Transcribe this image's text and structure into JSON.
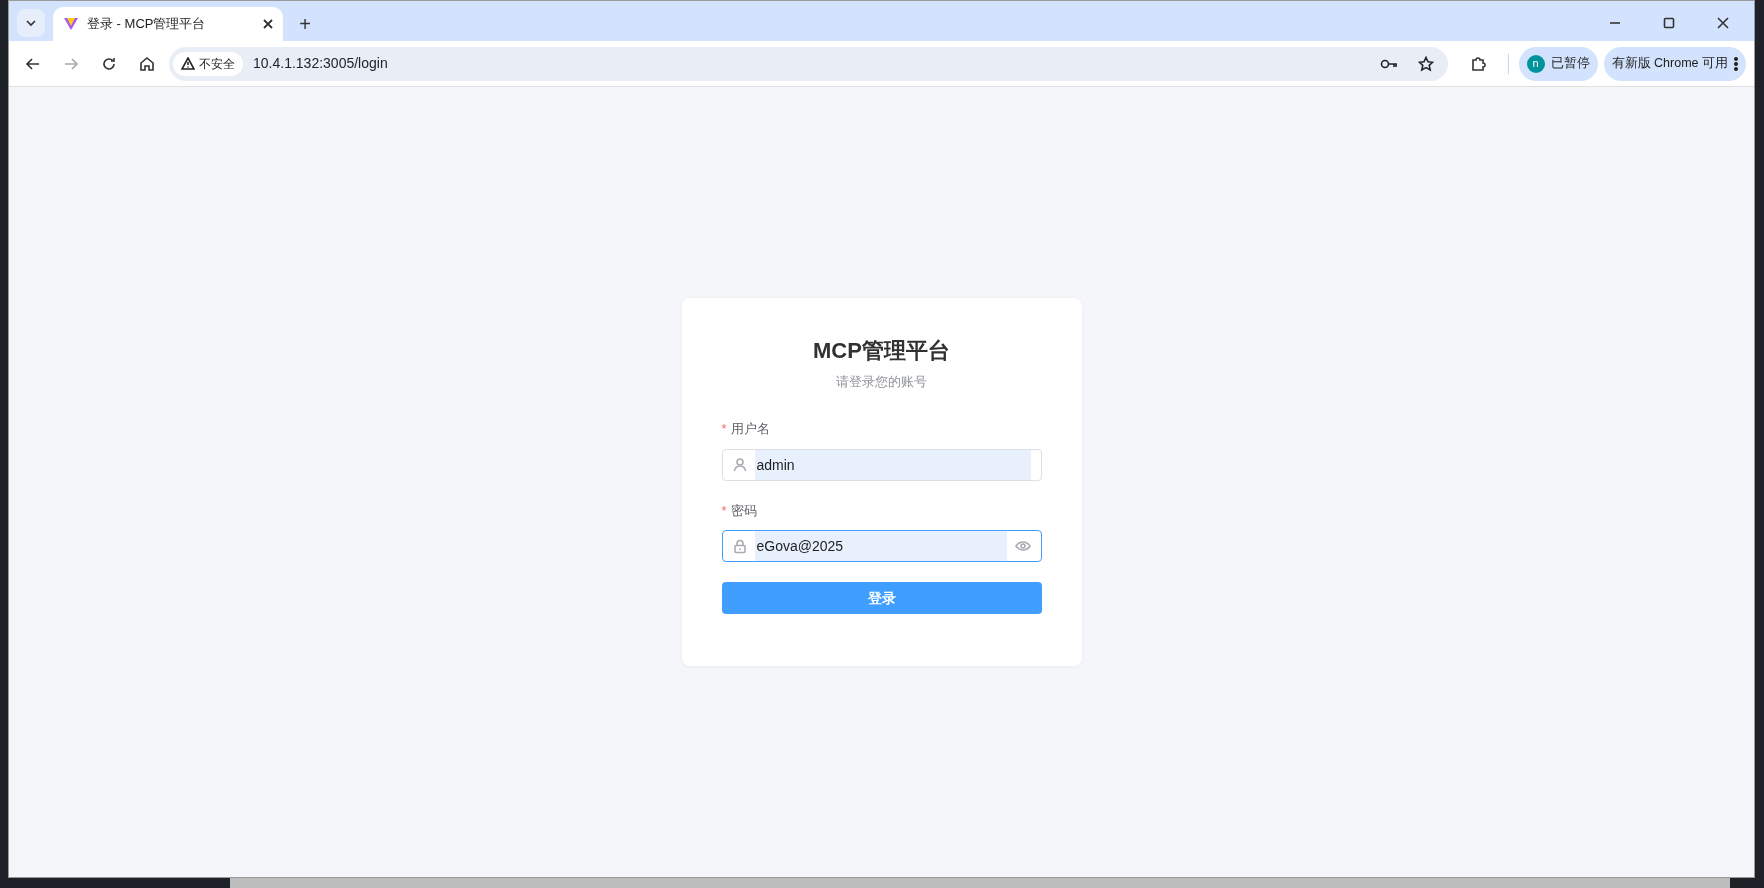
{
  "browser": {
    "tab": {
      "title": "登录 - MCP管理平台",
      "selected": true
    },
    "new_tab": "+",
    "security": "不安全",
    "url": "10.4.1.132:3005/login",
    "profile": {
      "initial": "n",
      "status": "已暂停"
    },
    "update": "有新版 Chrome 可用"
  },
  "login": {
    "title": "MCP管理平台",
    "subtitle": "请登录您的账号",
    "fields": [
      {
        "kind": "text",
        "label": "用户名",
        "required_mark": "*",
        "value": "admin",
        "focused": false
      },
      {
        "kind": "password",
        "label": "密码",
        "required_mark": "*",
        "value": "eGova@2025",
        "focused": true
      }
    ],
    "submit": "登录"
  }
}
